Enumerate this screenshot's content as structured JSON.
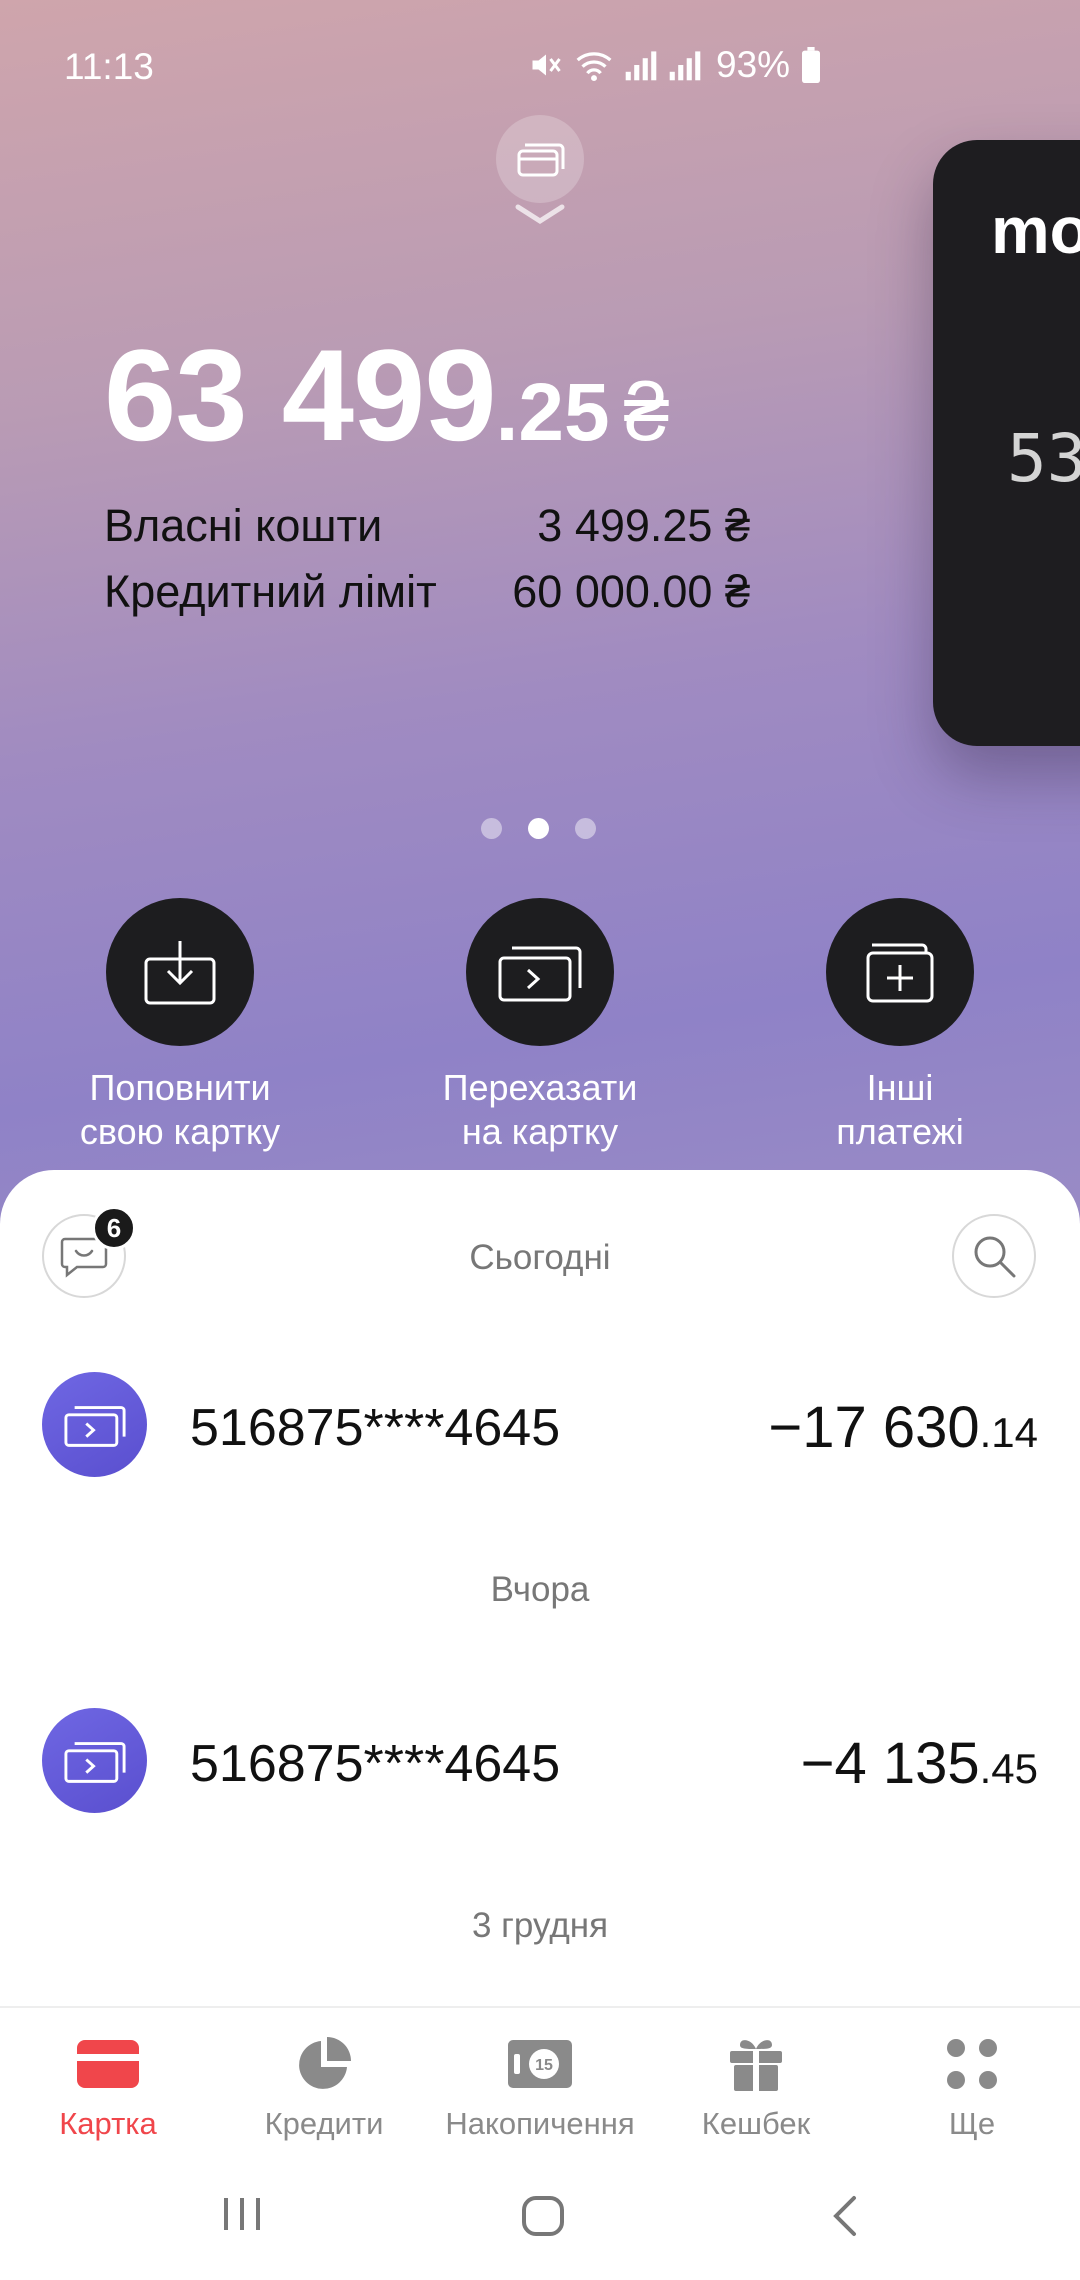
{
  "status_bar": {
    "time": "11:13",
    "battery": "93%"
  },
  "balance": {
    "integer": "63 499",
    "cents": ".25",
    "currency": "₴",
    "rows": [
      {
        "label": "Власні кошти",
        "value": "3 499.25 ₴"
      },
      {
        "label": "Кредитний ліміт",
        "value": "60 000.00 ₴"
      }
    ]
  },
  "card_preview": {
    "brand": "mo",
    "number_fragment": "53"
  },
  "carousel": {
    "pages": 3,
    "active_page": 2
  },
  "actions": [
    {
      "label": "Поповнити\nсвою картку",
      "icon": "download-icon"
    },
    {
      "label": "Перехазати\nна картку",
      "icon": "transfer-card-icon"
    },
    {
      "label": "Інші\nплатежі",
      "icon": "add-payment-icon"
    }
  ],
  "feed": {
    "chat_badge": "6",
    "groups": [
      {
        "date": "Сьогодні",
        "transactions": [
          {
            "name": "516875****4645",
            "amount_main": "−17 630",
            "amount_cents": ".14"
          }
        ]
      },
      {
        "date": "Вчора",
        "transactions": [
          {
            "name": "516875****4645",
            "amount_main": "−4 135",
            "amount_cents": ".45"
          }
        ]
      },
      {
        "date": "3 грудня",
        "transactions": []
      }
    ]
  },
  "bottom_nav": [
    {
      "label": "Картка",
      "icon": "card-icon",
      "active": true
    },
    {
      "label": "Кредити",
      "icon": "pie-chart-icon",
      "active": false
    },
    {
      "label": "Накопичення",
      "icon": "savings-icon",
      "active": false
    },
    {
      "label": "Кешбек",
      "icon": "gift-icon",
      "active": false
    },
    {
      "label": "Ще",
      "icon": "more-dots-icon",
      "active": false
    }
  ],
  "colors": {
    "accent": "#f0464b",
    "transaction_icon": "#5a4fcf",
    "dark_button": "#1d1d1f"
  }
}
